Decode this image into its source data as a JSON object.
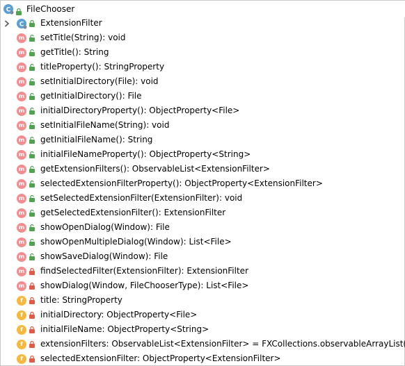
{
  "header": {
    "title": "FileChooser"
  },
  "nested_class": {
    "label": "ExtensionFilter"
  },
  "members": [
    {
      "kind": "m",
      "visibility": "public",
      "label": "setTitle(String): void"
    },
    {
      "kind": "m",
      "visibility": "public",
      "label": "getTitle(): String"
    },
    {
      "kind": "m",
      "visibility": "public",
      "label": "titleProperty(): StringProperty"
    },
    {
      "kind": "m",
      "visibility": "public",
      "label": "setInitialDirectory(File): void"
    },
    {
      "kind": "m",
      "visibility": "public",
      "label": "getInitialDirectory(): File"
    },
    {
      "kind": "m",
      "visibility": "public",
      "label": "initialDirectoryProperty(): ObjectProperty<File>"
    },
    {
      "kind": "m",
      "visibility": "public",
      "label": "setInitialFileName(String): void"
    },
    {
      "kind": "m",
      "visibility": "public",
      "label": "getInitialFileName(): String"
    },
    {
      "kind": "m",
      "visibility": "public",
      "label": "initialFileNameProperty(): ObjectProperty<String>"
    },
    {
      "kind": "m",
      "visibility": "public",
      "label": "getExtensionFilters(): ObservableList<ExtensionFilter>"
    },
    {
      "kind": "m",
      "visibility": "public",
      "label": "selectedExtensionFilterProperty(): ObjectProperty<ExtensionFilter>"
    },
    {
      "kind": "m",
      "visibility": "public",
      "label": "setSelectedExtensionFilter(ExtensionFilter): void"
    },
    {
      "kind": "m",
      "visibility": "public",
      "label": "getSelectedExtensionFilter(): ExtensionFilter"
    },
    {
      "kind": "m",
      "visibility": "public",
      "label": "showOpenDialog(Window): File"
    },
    {
      "kind": "m",
      "visibility": "public",
      "label": "showOpenMultipleDialog(Window): List<File>"
    },
    {
      "kind": "m",
      "visibility": "public",
      "label": "showSaveDialog(Window): File"
    },
    {
      "kind": "m",
      "visibility": "private",
      "label": "findSelectedFilter(ExtensionFilter): ExtensionFilter"
    },
    {
      "kind": "m",
      "visibility": "private",
      "label": "showDialog(Window, FileChooserType): List<File>"
    },
    {
      "kind": "f",
      "visibility": "private",
      "label": "title: StringProperty"
    },
    {
      "kind": "f",
      "visibility": "private",
      "label": "initialDirectory: ObjectProperty<File>"
    },
    {
      "kind": "f",
      "visibility": "private",
      "label": "initialFileName: ObjectProperty<String>"
    },
    {
      "kind": "f",
      "visibility": "private",
      "label": "extensionFilters: ObservableList<ExtensionFilter> = FXCollections.observableArrayList()"
    },
    {
      "kind": "f",
      "visibility": "private",
      "label": "selectedExtensionFilter: ObjectProperty<ExtensionFilter>"
    }
  ],
  "colors": {
    "method_icon": "#f38d8f",
    "field_icon": "#f7b93d",
    "class_icon": "#5aa0d6",
    "public_vis": "#4fa34f",
    "private_vis": "#e05a46"
  }
}
